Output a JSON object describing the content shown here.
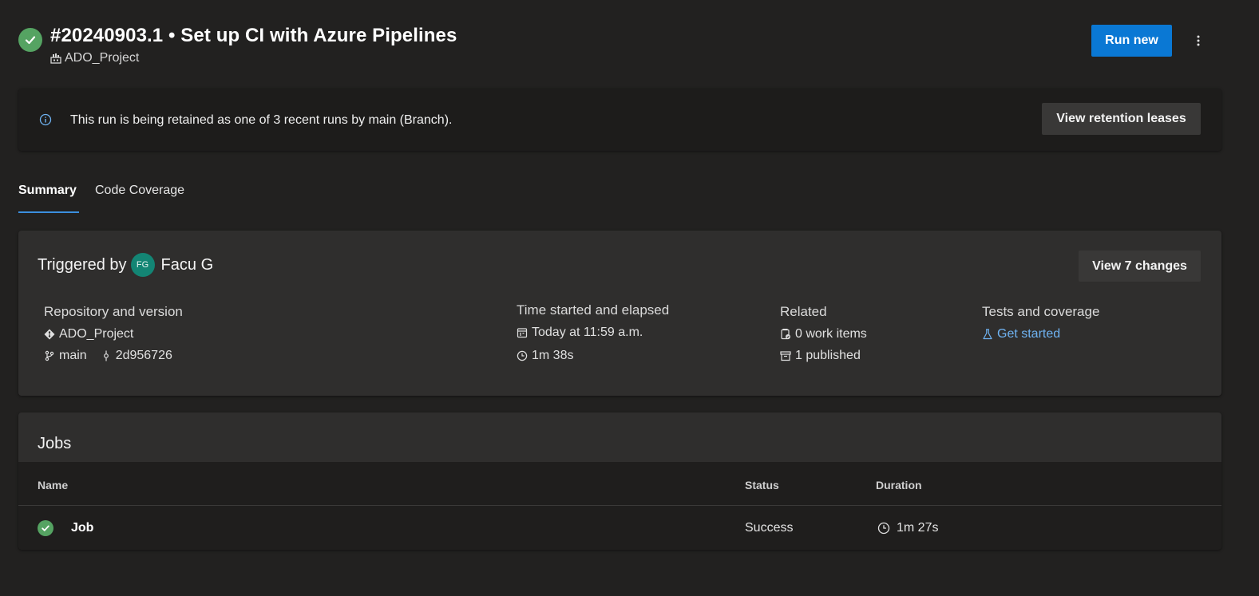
{
  "header": {
    "run_title": "#20240903.1 • Set up CI with Azure Pipelines",
    "project_name": "ADO_Project",
    "run_new_label": "Run new",
    "status_color": "#55a362",
    "accent_color": "#0a78d4"
  },
  "banner": {
    "message": "This run is being retained as one of 3 recent runs by main (Branch).",
    "button_label": "View retention leases",
    "icon": "info-icon"
  },
  "tabs": [
    {
      "label": "Summary",
      "active": true
    },
    {
      "label": "Code Coverage",
      "active": false
    }
  ],
  "summary": {
    "triggered_by_label": "Triggered by",
    "user_initials": "FG",
    "user_name": "Facu G",
    "changes_button": "View 7 changes",
    "repository": {
      "heading": "Repository and version",
      "repo_name": "ADO_Project",
      "branch": "main",
      "commit": "2d956726"
    },
    "time": {
      "heading": "Time started and elapsed",
      "started": "Today at 11:59 a.m.",
      "elapsed": "1m 38s"
    },
    "related": {
      "heading": "Related",
      "work_items": "0 work items",
      "published": "1 published"
    },
    "tests": {
      "heading": "Tests and coverage",
      "link": "Get started"
    }
  },
  "jobs": {
    "title": "Jobs",
    "columns": [
      "Name",
      "Status",
      "Duration"
    ],
    "rows": [
      {
        "name": "Job",
        "status": "Success",
        "duration": "1m 27s"
      }
    ]
  }
}
